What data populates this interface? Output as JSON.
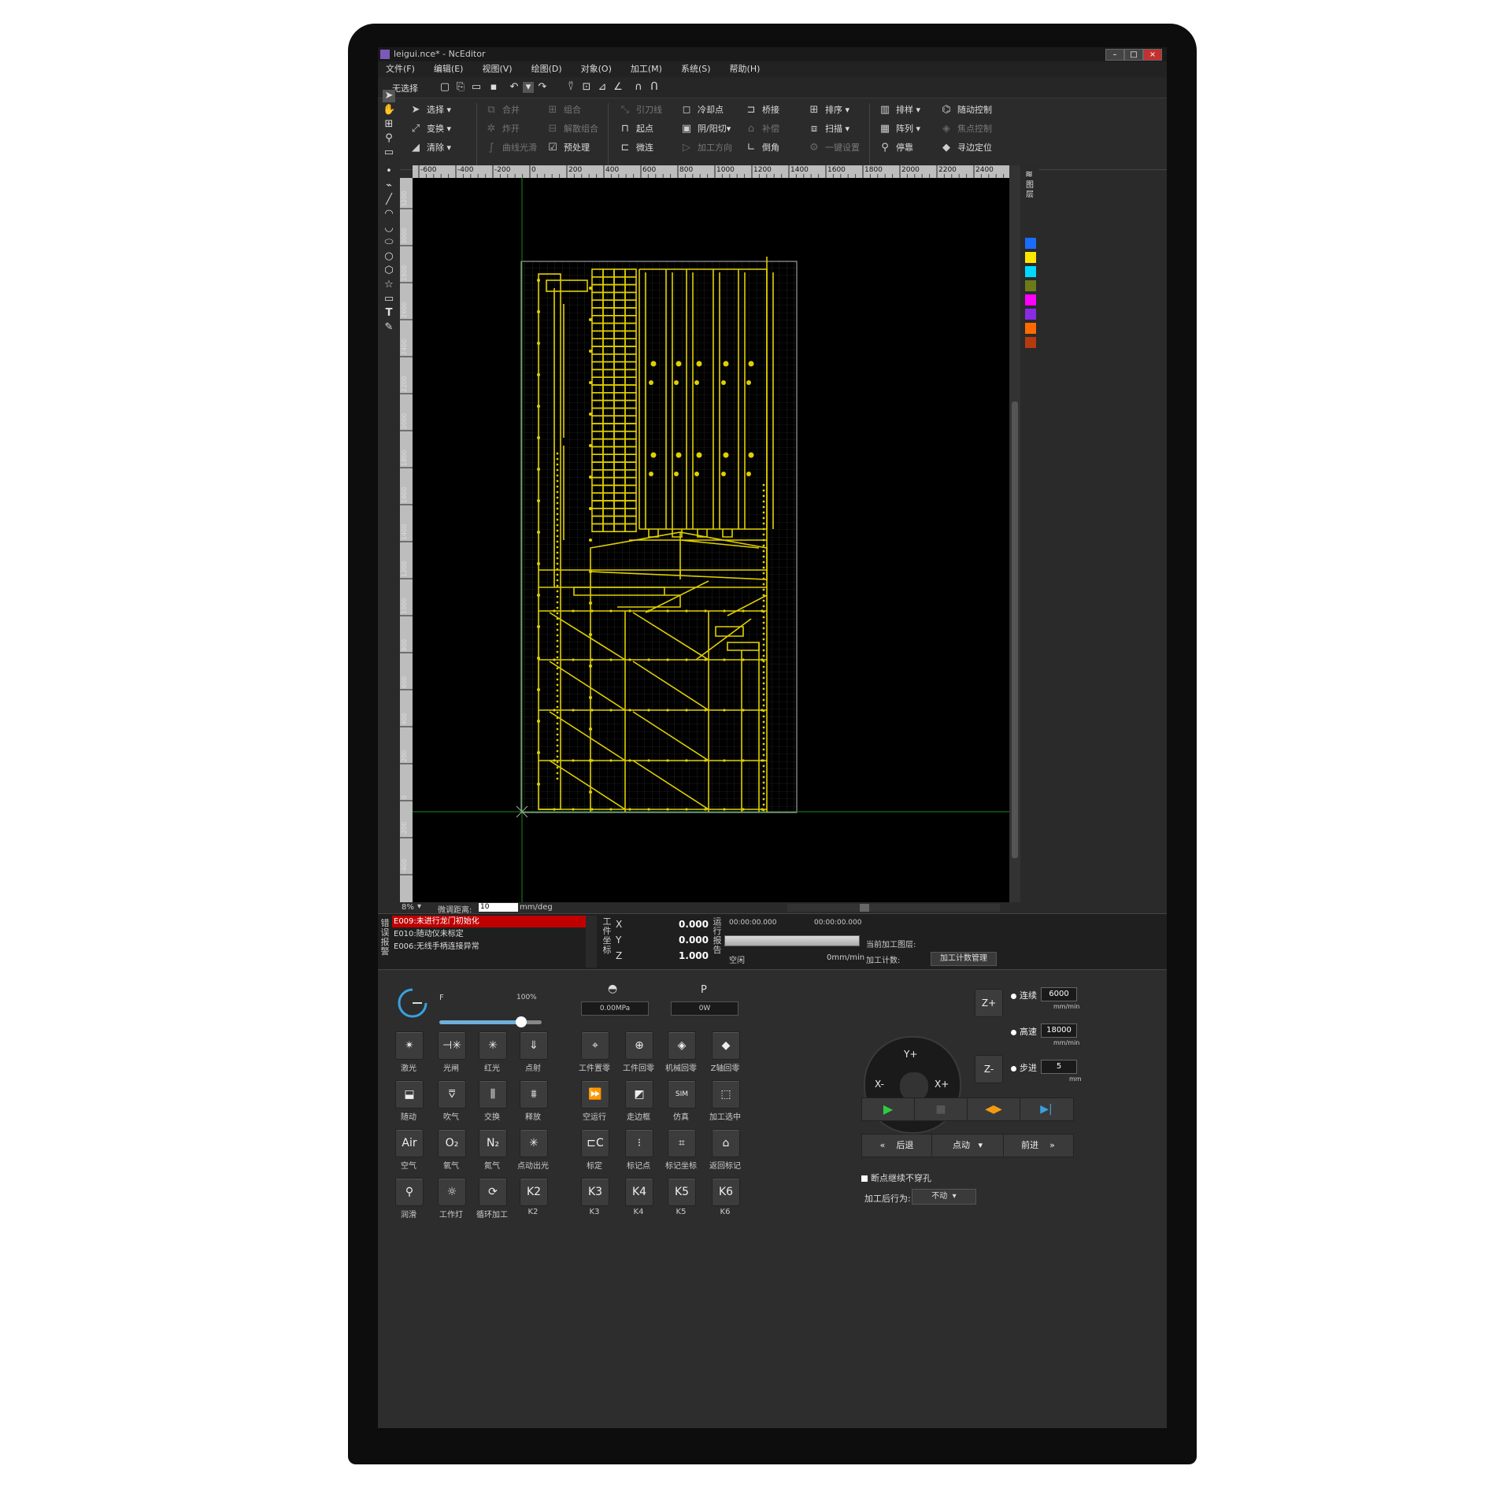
{
  "window": {
    "title": "leigui.nce* - NcEditor"
  },
  "menu": [
    "文件(F)",
    "编辑(E)",
    "视图(V)",
    "绘图(D)",
    "对象(O)",
    "加工(M)",
    "系统(S)",
    "帮助(H)"
  ],
  "quickbar": {
    "selection": "无选择"
  },
  "ribbon": {
    "select": "选择",
    "transform": "变换",
    "clear": "清除",
    "merge": "合并",
    "explode": "炸开",
    "smooth": "曲线光滑",
    "group": "组合",
    "ungroup": "解散组合",
    "preprocess": "预处理",
    "leadline": "引刀线",
    "startpoint": "起点",
    "microjoint": "微连",
    "coolpoint": "冷却点",
    "cutside": "阴/阳切",
    "direction": "加工方向",
    "bridge": "桥接",
    "compensate": "补偿",
    "chamfer": "倒角",
    "sort": "排序",
    "scan": "扫描",
    "onekey": "一键设置",
    "nest": "排样",
    "array": "阵列",
    "stop": "停靠",
    "follow": "随动控制",
    "focus": "焦点控制",
    "edgefind": "寻边定位"
  },
  "ruler_h": [
    "-600",
    "-400",
    "-200",
    "0",
    "200",
    "400",
    "600",
    "800",
    "1000",
    "1200",
    "1400",
    "1600",
    "1800",
    "2000",
    "2200",
    "2400"
  ],
  "ruler_v": [
    "3200",
    "3000",
    "2800",
    "2600",
    "2400",
    "2200",
    "2000",
    "1800",
    "1600",
    "1400",
    "1200",
    "1000",
    "800",
    "600",
    "400",
    "200",
    "0",
    "-200",
    "-400"
  ],
  "layers": {
    "label": "图层",
    "colors": [
      "#1a6cff",
      "#ffe600",
      "#00d8ff",
      "#6b7b1a",
      "#ff00ff",
      "#8a2be2",
      "#ff6a00",
      "#b53a10"
    ]
  },
  "status": {
    "zoom": "8%",
    "step_label": "微调距离:",
    "step_value": "10",
    "step_unit": "mm/deg"
  },
  "alarms": {
    "label": "错误报警",
    "items": [
      "E009:未进行龙门初始化",
      "E010:随动仪未标定",
      "E006:无线手柄连接异常"
    ]
  },
  "coords": {
    "label": "工件坐标",
    "x_label": "X",
    "x": "0.000",
    "y_label": "Y",
    "y": "0.000",
    "z_label": "Z",
    "z": "1.000"
  },
  "report": {
    "label": "运行报告",
    "time1": "00:00:00.000",
    "time2": "00:00:00.000",
    "layer_label": "当前加工图层:",
    "state": "空闲",
    "speed": "0mm/min",
    "count_label": "加工计数:",
    "count_button": "加工计数管理"
  },
  "feed": {
    "label": "F",
    "percent": "100%",
    "level": 0.8
  },
  "pressure": {
    "value": "0.00MPa"
  },
  "power": {
    "label": "P",
    "value": "0W"
  },
  "buttons_row1": [
    {
      "label": "激光",
      "icon": "laser-icon"
    },
    {
      "label": "光闸",
      "icon": "shutter-icon"
    },
    {
      "label": "红光",
      "icon": "red-light-icon"
    },
    {
      "label": "点射",
      "icon": "point-shot-icon"
    },
    {
      "label": "工件置零",
      "icon": "work-zero-icon"
    },
    {
      "label": "工件回零",
      "icon": "work-home-icon"
    },
    {
      "label": "机械回零",
      "icon": "machine-home-icon"
    },
    {
      "label": "Z轴回零",
      "icon": "z-home-icon"
    }
  ],
  "buttons_row2": [
    {
      "label": "随动",
      "icon": "follow-icon"
    },
    {
      "label": "吹气",
      "icon": "blow-icon"
    },
    {
      "label": "交换",
      "icon": "exchange-icon"
    },
    {
      "label": "释放",
      "icon": "release-icon"
    },
    {
      "label": "空运行",
      "icon": "dry-run-icon"
    },
    {
      "label": "走边框",
      "icon": "frame-icon"
    },
    {
      "label": "仿真",
      "icon": "simulate-icon"
    },
    {
      "label": "加工选中",
      "icon": "process-selected-icon"
    }
  ],
  "buttons_row3": [
    {
      "label": "空气",
      "text": "Air"
    },
    {
      "label": "氧气",
      "text": "O₂"
    },
    {
      "label": "氮气",
      "text": "N₂"
    },
    {
      "label": "点动出光",
      "text": "✳"
    },
    {
      "label": "标定",
      "text": "⊏C"
    },
    {
      "label": "标记点",
      "text": "⁝"
    },
    {
      "label": "标记坐标",
      "text": "⌗"
    },
    {
      "label": "返回标记",
      "text": "⌂"
    }
  ],
  "buttons_row4": [
    {
      "label": "润滑",
      "text": "⚲"
    },
    {
      "label": "工作灯",
      "text": "☼"
    },
    {
      "label": "循环加工",
      "text": "⟳"
    },
    {
      "label": "K2",
      "text": "K2"
    },
    {
      "label": "K3",
      "text": "K3"
    },
    {
      "label": "K4",
      "text": "K4"
    },
    {
      "label": "K5",
      "text": "K5"
    },
    {
      "label": "K6",
      "text": "K6"
    }
  ],
  "jog": {
    "yplus": "Y+",
    "yminus": "Y-",
    "xplus": "X+",
    "xminus": "X-",
    "zplus": "Z+",
    "zminus": "Z-",
    "mode_cont": "连续",
    "cont_value": "6000",
    "cont_unit": "mm/min",
    "mode_fast": "高速",
    "fast_value": "18000",
    "fast_unit": "mm/min",
    "mode_step": "步进",
    "step_value": "5",
    "step_unit": "mm"
  },
  "nav": {
    "back": "后退",
    "jog": "点动",
    "forward": "前进"
  },
  "options": {
    "breakpoint": "断点继续不穿孔",
    "after_label": "加工后行为:",
    "after_value": "不动"
  }
}
